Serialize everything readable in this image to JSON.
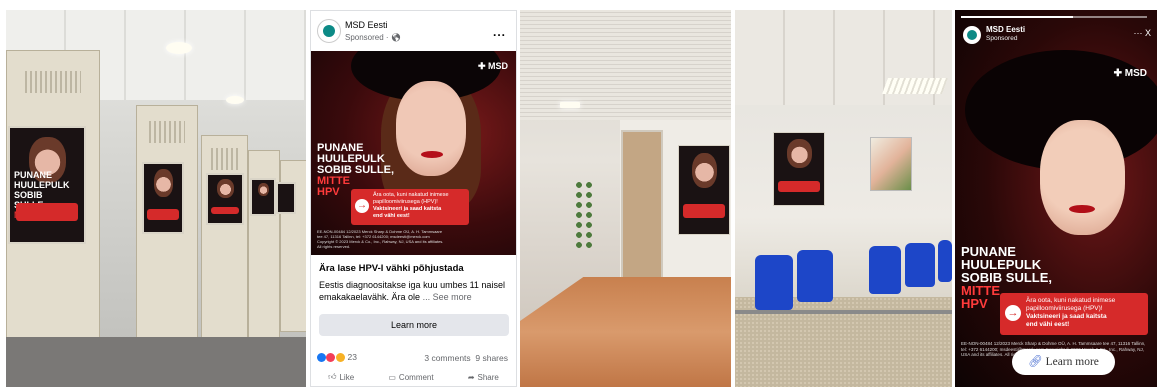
{
  "poster": {
    "headline_line1": "PUNANE",
    "headline_line2": "HUULEPULK",
    "headline_line3": "SOBIB SULLE,",
    "headline_line4": "MITTE",
    "headline_line5": "HPV",
    "red_box_line1": "Ära oota, kuni nakatud inimese",
    "red_box_line2": "papilloomiviirusega (HPV)!",
    "red_box_line3": "Vaktsineeri ja saad kaitsta",
    "red_box_line4": "end vähi eest!",
    "brand": "MSD",
    "fine_print": "EE-NON-00484 12/2023 Merck Sharp & Dohme OÜ, A. H. Tammsaare tee 47, 11316 Tallinn, tel: +372 6144200; msdeesti@merck.com Copyright © 2023 Merck & Co., Inc., Rahway, NJ, USA and its affiliates. All rights reserved."
  },
  "facebook_post": {
    "page_name": "MSD Eesti",
    "sponsored_label": "Sponsored · ",
    "more_icon": "...",
    "title": "Ära lase HPV-l vähki põhjustada",
    "body": "Eestis diagnoositakse iga kuu umbes 11 naisel emakakaelavähk. Ära ole",
    "see_more": "... See more",
    "cta": "Learn more",
    "reaction_count": "23",
    "comments": "3 comments",
    "shares": "9 shares",
    "actions": [
      "Like",
      "Comment",
      "Share"
    ]
  },
  "story": {
    "page_name": "MSD Eesti",
    "sponsored_label": "Sponsored",
    "controls": "··· X",
    "cta": "Learn more"
  },
  "colors": {
    "accent_red": "#d62a2a",
    "brand_teal": "#0c8a86",
    "chair_blue": "#1d46c8"
  }
}
